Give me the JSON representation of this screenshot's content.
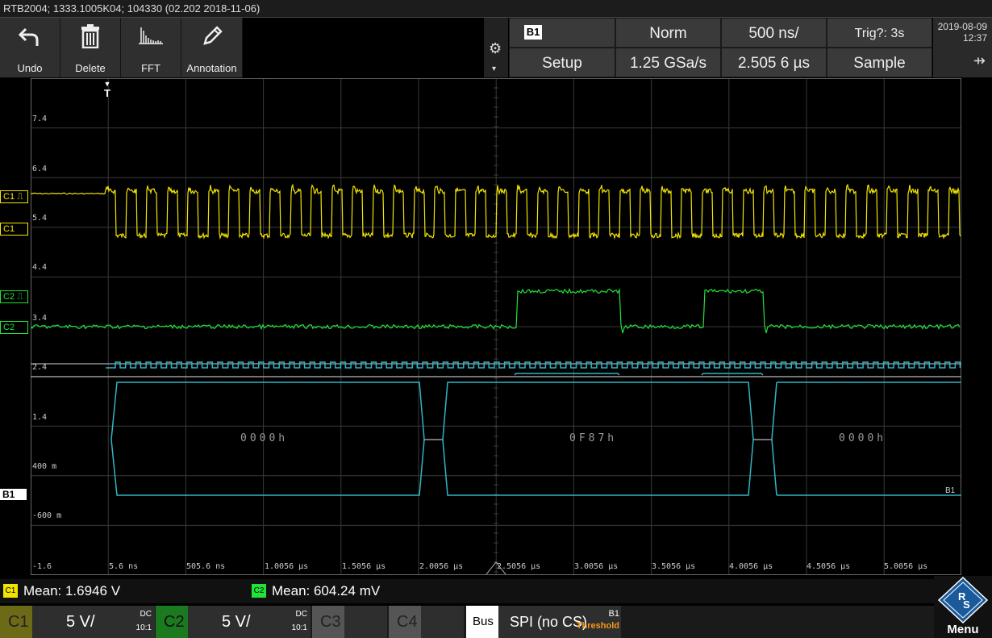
{
  "title": "RTB2004; 1333.1005K04; 104330 (02.202 2018-11-06)",
  "toolbar": {
    "undo": "Undo",
    "delete": "Delete",
    "fft": "FFT",
    "annotation": "Annotation"
  },
  "header": {
    "bus_tag": "B1",
    "trigger_mode": "Norm",
    "timebase": "500 ns/",
    "trig_status": "Trig?: 3s",
    "setup": "Setup",
    "sample_rate": "1.25 GSa/s",
    "position": "2.505 6 µs",
    "acq_mode": "Sample",
    "date": "2019-08-09",
    "time": "12:37"
  },
  "grid": {
    "trigger_marker": "T",
    "y_labels": [
      "7.4",
      "6.4",
      "5.4",
      "4.4",
      "3.4",
      "2.4",
      "1.4",
      "400 m",
      "-600 m",
      "-1.6"
    ],
    "x_labels": [
      "5.6 ns",
      "505.6 ns",
      "1.0056 µs",
      "1.5056 µs",
      "2.0056 µs",
      "2.5056 µs",
      "3.0056 µs",
      "3.5056 µs",
      "4.0056 µs",
      "4.5056 µs",
      "5.0056 µs"
    ],
    "channel_tags": {
      "c1_trig": "C1 ⎍",
      "c1": "C1",
      "c2_trig": "C2 ⎍",
      "c2": "C2",
      "b1": "B1",
      "b1_end": "B1"
    },
    "decode_frames": [
      "0000h",
      "0F87h",
      "0000h"
    ]
  },
  "measurements": {
    "c1_chip": "C1",
    "c1_text": "Mean: 1.6946 V",
    "c2_chip": "C2",
    "c2_text": "Mean: 604.24 mV"
  },
  "channels": {
    "c1": {
      "label": "C1",
      "scale": "5 V/",
      "coupling": "DC",
      "probe": "10:1"
    },
    "c2": {
      "label": "C2",
      "scale": "5 V/",
      "coupling": "DC",
      "probe": "10:1"
    },
    "c3": {
      "label": "C3"
    },
    "c4": {
      "label": "C4"
    },
    "bus": {
      "label": "Bus",
      "protocol": "SPI (no CS)",
      "tag": "B1",
      "threshold": "Threshold"
    },
    "menu": "Menu"
  },
  "colors": {
    "c1": "#f2e400",
    "c2": "#22e23a",
    "bus": "#2fb6c4",
    "threshold": "#f39a1a"
  }
}
